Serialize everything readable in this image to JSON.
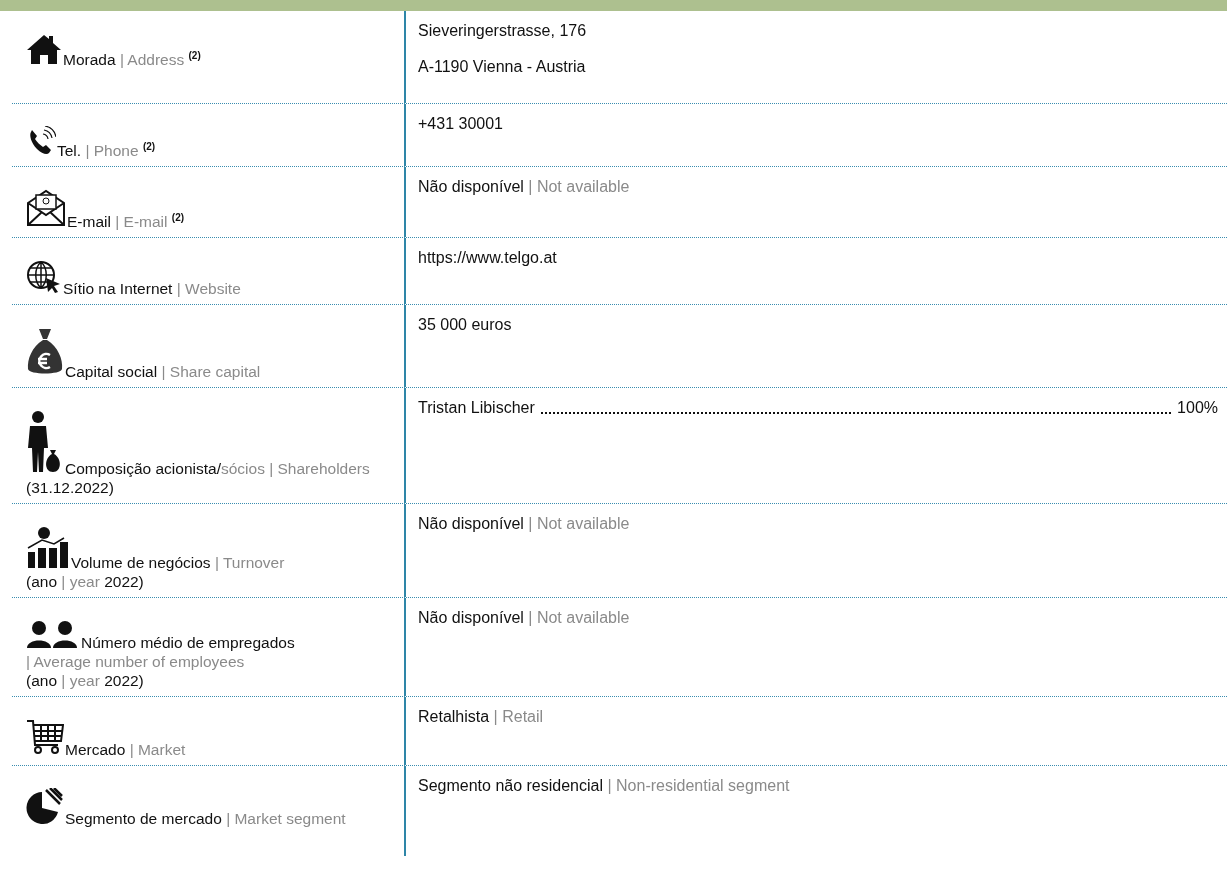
{
  "rows": [
    {
      "kind": "address",
      "label": [
        [
          {
            "text": "Morada ",
            "muted": false
          },
          {
            "text": "| Address ",
            "muted": true
          },
          {
            "text": "(2)",
            "muted": false,
            "superscript": true
          }
        ]
      ],
      "values": [
        [
          {
            "text": "Sieveringerstrasse, 176",
            "muted": false
          }
        ],
        [
          {
            "text": "A-1190 Vienna - Austria",
            "muted": false
          }
        ]
      ]
    },
    {
      "kind": "phone",
      "label": [
        [
          {
            "text": "Tel. ",
            "muted": false
          },
          {
            "text": "| Phone ",
            "muted": true
          },
          {
            "text": "(2)",
            "muted": false,
            "superscript": true
          }
        ]
      ],
      "values": [
        [
          {
            "text": "+431 30001",
            "muted": false
          }
        ]
      ]
    },
    {
      "kind": "email",
      "label": [
        [
          {
            "text": "E-mail ",
            "muted": false
          },
          {
            "text": "| E-mail ",
            "muted": true
          },
          {
            "text": "(2)",
            "muted": false,
            "superscript": true
          }
        ]
      ],
      "values": [
        [
          {
            "text": "Não disponível ",
            "muted": false
          },
          {
            "text": "| Not available",
            "muted": true
          }
        ]
      ]
    },
    {
      "kind": "website",
      "label": [
        [
          {
            "text": "Sítio na Internet ",
            "muted": false
          },
          {
            "text": "| Website",
            "muted": true
          }
        ]
      ],
      "values": [
        [
          {
            "text": "https://www.telgo.at",
            "muted": false
          }
        ]
      ]
    },
    {
      "kind": "capital",
      "label": [
        [
          {
            "text": "Capital social ",
            "muted": false
          },
          {
            "text": "| Share capital",
            "muted": true
          }
        ]
      ],
      "values": [
        [
          {
            "text": "35 000 euros",
            "muted": false
          }
        ]
      ]
    },
    {
      "kind": "shareholders",
      "label": [
        [
          {
            "text": "Composição acionista/",
            "muted": false
          },
          {
            "text": "sócios | Shareholders ",
            "muted": true
          },
          {
            "text": "(31.12.2022)",
            "muted": false
          }
        ]
      ],
      "shareholders": [
        {
          "name": "Tristan Libischer",
          "share": "100%"
        }
      ]
    },
    {
      "kind": "turnover",
      "label": [
        [
          {
            "text": "Volume de negócios ",
            "muted": false
          },
          {
            "text": "| Turnover",
            "muted": true
          }
        ],
        [
          {
            "text": "(ano ",
            "muted": false
          },
          {
            "text": "| year ",
            "muted": true
          },
          {
            "text": "2022)",
            "muted": false
          }
        ]
      ],
      "values": [
        [
          {
            "text": "Não disponível ",
            "muted": false
          },
          {
            "text": "| Not available",
            "muted": true
          }
        ]
      ]
    },
    {
      "kind": "employees",
      "label": [
        [
          {
            "text": "Número médio de empregados",
            "muted": false
          }
        ],
        [
          {
            "text": "| Average number of employees",
            "muted": true
          }
        ],
        [
          {
            "text": "(ano ",
            "muted": false
          },
          {
            "text": "| year ",
            "muted": true
          },
          {
            "text": "2022)",
            "muted": false
          }
        ]
      ],
      "values": [
        [
          {
            "text": "Não disponível ",
            "muted": false
          },
          {
            "text": "| Not available",
            "muted": true
          }
        ]
      ]
    },
    {
      "kind": "market",
      "label": [
        [
          {
            "text": "Mercado ",
            "muted": false
          },
          {
            "text": "| Market",
            "muted": true
          }
        ]
      ],
      "values": [
        [
          {
            "text": "Retalhista ",
            "muted": false
          },
          {
            "text": "| Retail",
            "muted": true
          }
        ]
      ]
    },
    {
      "kind": "segment",
      "label": [
        [
          {
            "text": "Segmento de mercado ",
            "muted": false
          },
          {
            "text": "| Market segment",
            "muted": true
          }
        ]
      ],
      "values": [
        [
          {
            "text": "Segmento não residencial ",
            "muted": false
          },
          {
            "text": "| Non-residential segment",
            "muted": true
          }
        ]
      ]
    }
  ]
}
